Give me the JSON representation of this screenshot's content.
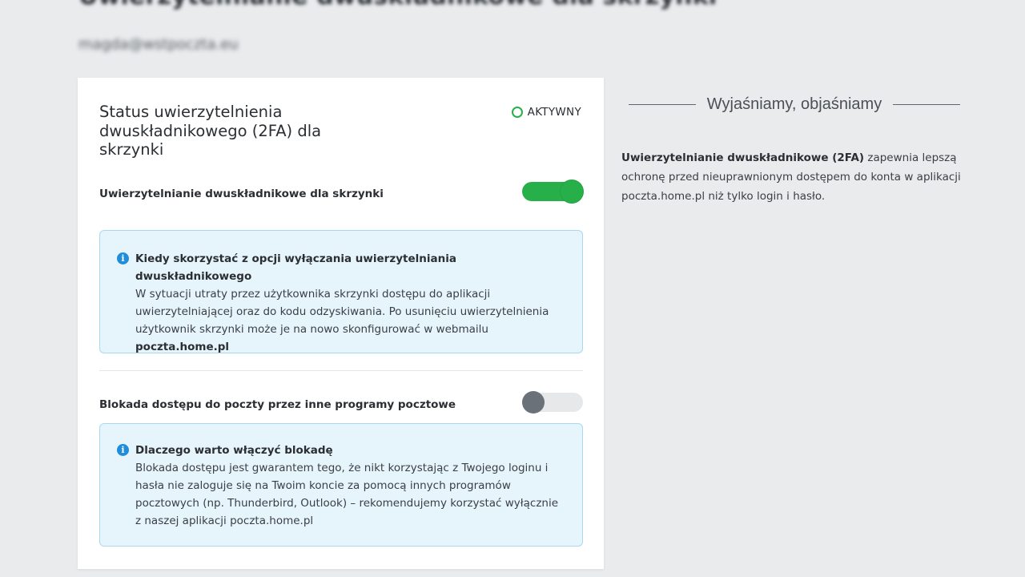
{
  "header": {
    "page_title": "Uwierzytelnianie dwuskładnikowe dla skrzynki",
    "email": "magda@wstpoczta.eu"
  },
  "status_card": {
    "title": "Status uwierzytelnienia dwuskładnikowego (2FA) dla skrzynki",
    "status_label": "AKTYWNY",
    "status_color": "#27b04a",
    "two_factor": {
      "label": "Uwierzytelnianie dwuskładnikowe dla skrzynki",
      "enabled": true,
      "info_title": "Kiedy skorzystać z opcji wyłączania uwierzytelniania dwuskładnikowego",
      "info_body": "W sytuacji utraty przez użytkownika skrzynki dostępu do aplikacji uwierzytelniającej oraz do kodu odzyskiwania. Po usunięciu uwierzytelnienia użytkownik skrzynki może je na nowo skonfigurować w webmailu",
      "info_link": "poczta.home.pl"
    },
    "block_access": {
      "label": "Blokada dostępu do poczty przez inne programy pocztowe",
      "enabled": false,
      "info_title": "Dlaczego warto włączyć blokadę",
      "info_body": "Blokada dostępu jest gwarantem tego, że nikt korzystając z Twojego loginu i hasła nie zaloguje się na Twoim koncie za pomocą innych programów pocztowych (np. Thunderbird, Outlook) – rekomendujemy korzystać wyłącznie z naszej aplikacji poczta.home.pl"
    }
  },
  "sidebar": {
    "heading": "Wyjaśniamy, objaśniamy",
    "paragraph_bold": "Uwierzytelnianie dwuskładnikowe (2FA)",
    "paragraph_rest": " zapewnia lepszą ochronę przed nieuprawnionym dostępem do konta w aplikacji poczta.home.pl niż tylko login i hasło."
  },
  "icons": {
    "info": "info-icon",
    "status": "status-dot-icon"
  },
  "colors": {
    "toggle_on": "#27b04a",
    "toggle_off_knob": "#6a7179",
    "info_background": "#e6f4fc",
    "info_icon": "#1f8ddb"
  }
}
